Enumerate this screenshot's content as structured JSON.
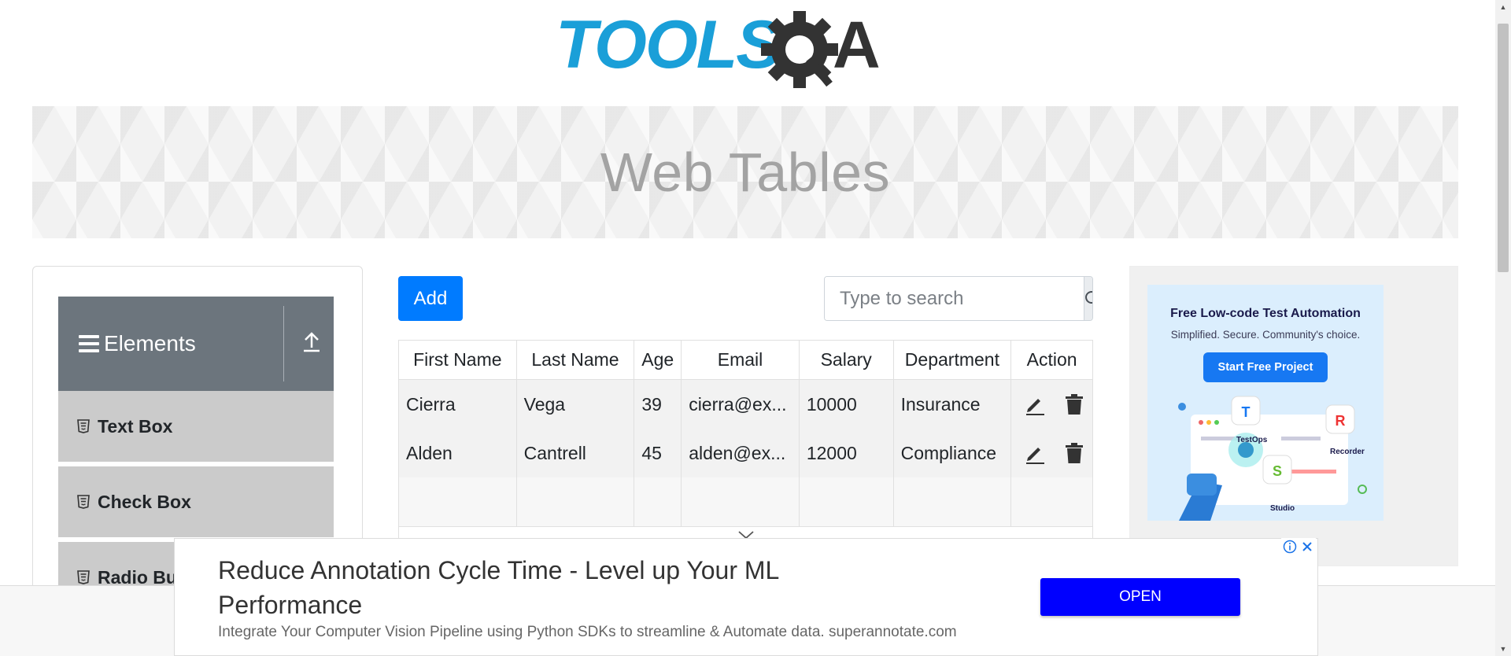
{
  "logo": {
    "text_left": "TOOLS",
    "text_q": "Q",
    "text_right": "A"
  },
  "banner": {
    "title": "Web Tables"
  },
  "sidebar": {
    "group": {
      "title": "Elements",
      "icon": "hamburger-icon",
      "toggle_icon": "arrow-up-icon"
    },
    "items": [
      {
        "label": "Text Box",
        "icon": "html5-icon"
      },
      {
        "label": "Check Box",
        "icon": "html5-icon"
      },
      {
        "label": "Radio Bu",
        "icon": "html5-icon"
      }
    ]
  },
  "toolbar": {
    "add_label": "Add",
    "search_placeholder": "Type to search",
    "search_icon": "search-icon"
  },
  "table": {
    "columns": [
      "First Name",
      "Last Name",
      "Age",
      "Email",
      "Salary",
      "Department",
      "Action"
    ],
    "rows": [
      [
        "Cierra",
        "Vega",
        "39",
        "cierra@ex...",
        "10000",
        "Insurance"
      ],
      [
        "Alden",
        "Cantrell",
        "45",
        "alden@ex...",
        "12000",
        "Compliance"
      ]
    ],
    "action_icons": [
      "edit-icon",
      "delete-icon"
    ]
  },
  "side_ad": {
    "title": "Free Low-code Test Automation",
    "subtitle": "Simplified. Secure. Community's choice.",
    "button": "Start Free Project",
    "tags": [
      "TestOps",
      "Recorder",
      "Studio"
    ]
  },
  "bottom_ad": {
    "title": "Reduce Annotation Cycle Time - Level up Your ML Performance",
    "description": "Integrate Your Computer Vision Pipeline using Python SDKs to streamline & Automate data. superannotate.com",
    "button": "OPEN"
  },
  "colors": {
    "primary": "#007bff",
    "sidebar_header": "#6c757d",
    "sidebar_item": "#cbcbcb",
    "logo_blue": "#1a9fd8",
    "logo_dark": "#333333",
    "ad_button": "#0000ff"
  }
}
